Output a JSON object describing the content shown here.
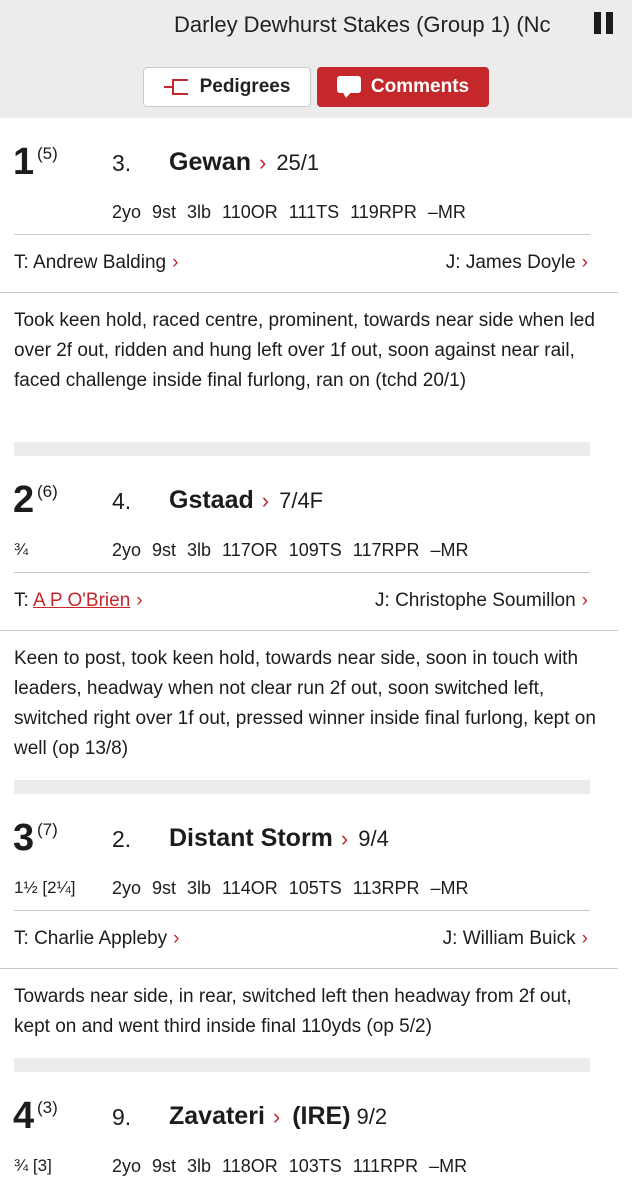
{
  "header": {
    "race_title": "Darley Dewhurst Stakes (Group 1) (Nc",
    "pause_icon": "pause-icon"
  },
  "tabs": {
    "pedigrees_label": "Pedigrees",
    "comments_label": "Comments",
    "active": "Comments"
  },
  "colors": {
    "accent": "#c5282b",
    "header_bg": "#ececec",
    "divider": "#c9c9c9"
  },
  "runners": [
    {
      "position": "1",
      "draw": "(5)",
      "margin": "",
      "saddle_cloth": "3.",
      "horse": "Gewan",
      "horse_suffix": "",
      "odds": "25/1",
      "stats": "2yo 9st 3lb 110OR 111TS 119RPR –MR",
      "trainer_prefix": "T:",
      "trainer": "Andrew Balding",
      "jockey_prefix": "J:",
      "jockey": "James Doyle",
      "comment": "Took keen hold, raced centre, prominent, towards near side when led over 2f out, ridden and hung left over 1f out, soon against near rail, faced challenge inside final furlong, ran on (tchd 20/1)"
    },
    {
      "position": "2",
      "draw": "(6)",
      "margin": "¾",
      "saddle_cloth": "4.",
      "horse": "Gstaad",
      "horse_suffix": "",
      "odds": "7/4F",
      "stats": "2yo 9st 3lb 117OR 109TS 117RPR –MR",
      "trainer_prefix": "T:",
      "trainer": "A P O'Brien",
      "jockey_prefix": "J:",
      "jockey": "Christophe Soumillon",
      "comment": "Keen to post, took keen hold, towards near side, soon in touch with leaders, headway when not clear run 2f out, soon switched left, switched right over 1f out, pressed winner inside final furlong, kept on well (op 13/8)"
    },
    {
      "position": "3",
      "draw": "(7)",
      "margin": "1½ [2¼]",
      "saddle_cloth": "2.",
      "horse": "Distant Storm",
      "horse_suffix": "",
      "odds": "9/4",
      "stats": "2yo 9st 3lb 114OR 105TS 113RPR –MR",
      "trainer_prefix": "T:",
      "trainer": "Charlie Appleby",
      "jockey_prefix": "J:",
      "jockey": "William Buick",
      "comment": "Towards near side, in rear, switched left then headway from 2f out, kept on and went third inside final 110yds (op 5/2)"
    },
    {
      "position": "4",
      "draw": "(3)",
      "margin": "¾ [3]",
      "saddle_cloth": "9.",
      "horse": "Zavateri",
      "horse_suffix": "(IRE)",
      "odds": "9/2",
      "stats": "2yo 9st 3lb 118OR 103TS 111RPR –MR"
    }
  ]
}
